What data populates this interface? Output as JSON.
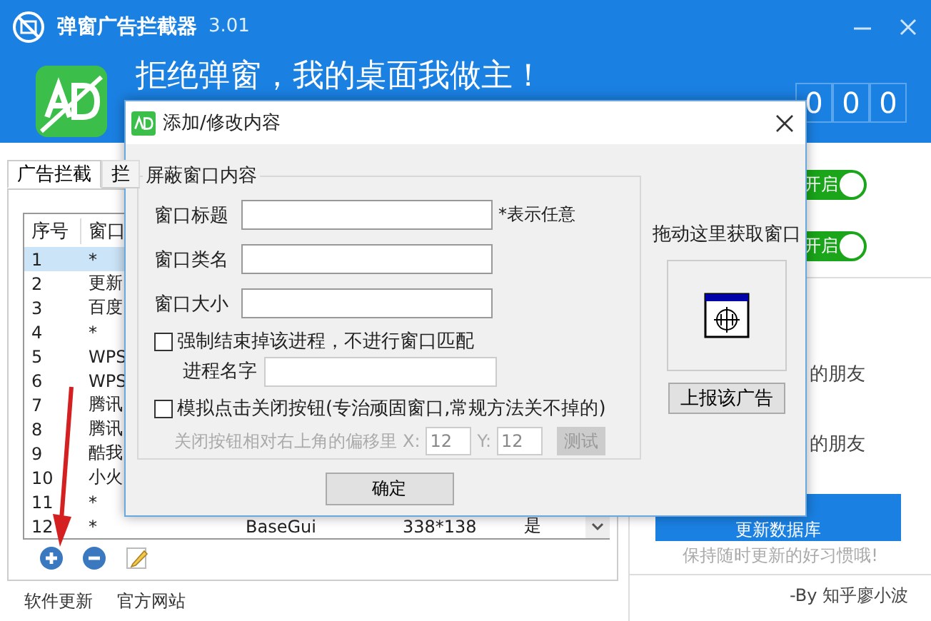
{
  "window": {
    "title": "弹窗广告拦截器",
    "version": "3.01"
  },
  "banner": {
    "slogan": "拒绝弹窗，我的桌面我做主！",
    "counter": [
      "0",
      "0",
      "0"
    ]
  },
  "tabs": [
    {
      "label": "广告拦截",
      "selected": true
    },
    {
      "label": "拦",
      "selected": false
    }
  ],
  "table": {
    "columns": [
      "序号",
      "窗口"
    ],
    "rows": [
      {
        "cells": [
          "1",
          "*"
        ],
        "selected": true
      },
      {
        "cells": [
          "2",
          "更新"
        ],
        "selected": false
      },
      {
        "cells": [
          "3",
          "百度"
        ],
        "selected": false
      },
      {
        "cells": [
          "4",
          "*"
        ],
        "selected": false
      },
      {
        "cells": [
          "5",
          "WPS"
        ],
        "selected": false
      },
      {
        "cells": [
          "6",
          "WPS"
        ],
        "selected": false
      },
      {
        "cells": [
          "7",
          "腾讯"
        ],
        "selected": false
      },
      {
        "cells": [
          "8",
          "腾讯"
        ],
        "selected": false
      },
      {
        "cells": [
          "9",
          "酷我"
        ],
        "selected": false
      },
      {
        "cells": [
          "10",
          "小火"
        ],
        "selected": false
      },
      {
        "cells": [
          "11",
          "*"
        ],
        "selected": false
      },
      {
        "cells": [
          "12",
          "*",
          "BaseGui",
          "338*138",
          "是"
        ],
        "selected": false
      }
    ]
  },
  "right_panel": {
    "toggles": [
      {
        "label": "开启",
        "on": true
      },
      {
        "label": "开启",
        "on": true
      }
    ],
    "notes": [
      "的朋友",
      "的朋友"
    ],
    "update_button": "更新数据库",
    "caption": "保持随时更新的好习惯哦!"
  },
  "footer": {
    "links": [
      "软件更新",
      "官方网站"
    ],
    "credit": "-By 知乎廖小波"
  },
  "dialog": {
    "title": "添加/修改内容",
    "group_title": "屏蔽窗口内容",
    "fields": [
      {
        "label": "窗口标题",
        "hint": "*表示任意"
      },
      {
        "label": "窗口类名"
      },
      {
        "label": "窗口大小"
      }
    ],
    "kill_process": {
      "label": "强制结束掉该进程，不进行窗口匹配",
      "checked": false,
      "field_label": "进程名字"
    },
    "simulate_close": {
      "label": "模拟点击关闭按钮(专治顽固窗口,常规方法关不掉的)",
      "checked": false,
      "offset_label": "关闭按钮相对右上角的偏移里",
      "x_label": "X:",
      "x_value": "12",
      "y_label": "Y:",
      "y_value": "12",
      "test_button": "测试",
      "disabled": true
    },
    "picker_label": "拖动这里获取窗口",
    "report_button": "上报该广告",
    "ok_button": "确定"
  }
}
